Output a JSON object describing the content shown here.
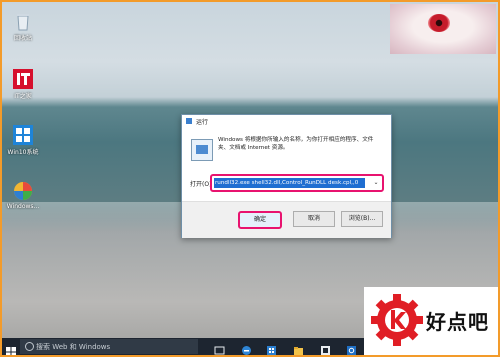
{
  "desktop": {
    "icons": [
      {
        "label": "回收站"
      },
      {
        "label": "IT之家"
      },
      {
        "label": "Win10系统"
      },
      {
        "label": "Windows..."
      }
    ]
  },
  "run_dialog": {
    "title": "运行",
    "description": "Windows 将根据你所输入的名称，为你打开相应的程序、文件夹、文档或 Internet 资源。",
    "open_label": "打开(O):",
    "command_value": "rundll32.exe shell32.dll,Control_RunDLL desk.cpl,,0",
    "ok_label": "确定",
    "cancel_label": "取消",
    "browse_label": "浏览(B)..."
  },
  "taskbar": {
    "search_placeholder": "搜索 Web 和 Windows"
  },
  "watermark": {
    "brand": "好点吧"
  },
  "colors": {
    "highlight": "#e8136f",
    "selection": "#1f6ed1",
    "frame_border": "#f39b2a",
    "taskbar": "#1d2530",
    "logo_red": "#e01e25"
  }
}
